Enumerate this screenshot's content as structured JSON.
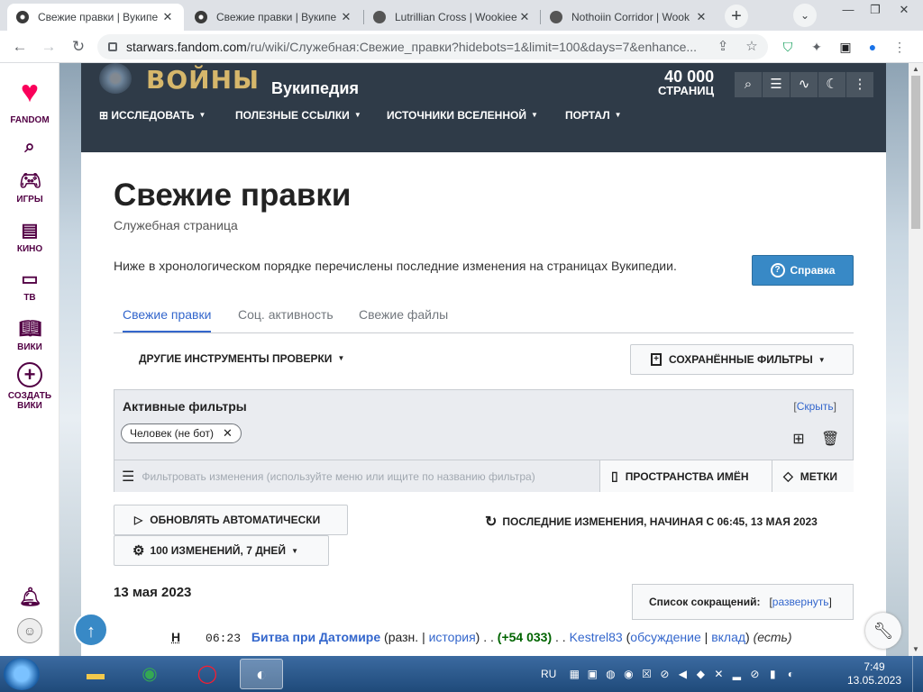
{
  "browser": {
    "tabs": [
      {
        "title": "Свежие правки | Вукипе",
        "active": true
      },
      {
        "title": "Свежие правки | Вукипе",
        "active": false
      },
      {
        "title": "Lutrillian Cross | Wookiee",
        "active": false
      },
      {
        "title": "Nothoiin Corridor | Wook",
        "active": false
      }
    ],
    "new_tab": "+",
    "url_host": "starwars.fandom.com",
    "url_rest": "/ru/wiki/Служебная:Свежие_правки?hidebots=1&limit=100&days=7&enhance..."
  },
  "rail": {
    "items": [
      {
        "label": "FANDOM",
        "icon": "fandom-logo-icon"
      },
      {
        "label": "",
        "icon": "search-icon"
      },
      {
        "label": "ИГРЫ",
        "icon": "gamepad-icon"
      },
      {
        "label": "КИНО",
        "icon": "clapperboard-icon"
      },
      {
        "label": "ТВ",
        "icon": "tv-icon"
      },
      {
        "label": "ВИКИ",
        "icon": "book-icon"
      },
      {
        "label": "СОЗДАТЬ ВИКИ",
        "icon": "plus-circle-icon"
      }
    ]
  },
  "wiki": {
    "logo_text": "ВОЙНЫ",
    "name": "Вукипедия",
    "page_count": "40 000",
    "page_count_label": "СТРАНИЦ",
    "nav": [
      {
        "label": "ИССЛЕДОВАТЬ",
        "icon": "explore-icon"
      },
      {
        "label": "ПОЛЕЗНЫЕ ССЫЛКИ"
      },
      {
        "label": "ИСТОЧНИКИ ВСЕЛЕННОЙ"
      },
      {
        "label": "ПОРТАЛ"
      }
    ]
  },
  "page": {
    "title": "Свежие правки",
    "subtitle": "Служебная страница",
    "intro": "Ниже в хронологическом порядке перечислены последние изменения на страницах Вукипедии.",
    "help_label": "Справка",
    "subtabs": [
      "Свежие правки",
      "Соц. активность",
      "Свежие файлы"
    ],
    "tools_label": "ДРУГИЕ ИНСТРУМЕНТЫ ПРОВЕРКИ",
    "saved_filters_label": "СОХРАНЁННЫЕ ФИЛЬТРЫ",
    "active_filters_title": "Активные фильтры",
    "hide_link": "Скрыть",
    "filter_chip": "Человек (не бот)",
    "filter_placeholder": "Фильтровать изменения (используйте меню или ищите по названию фильтра)",
    "namespaces_label": "ПРОСТРАНСТВА ИМЁН",
    "tags_label": "МЕТКИ",
    "auto_update_label": "ОБНОВЛЯТЬ АВТОМАТИЧЕСКИ",
    "since_label": "ПОСЛЕДНИЕ ИЗМЕНЕНИЯ, НАЧИНАЯ С 06:45, 13 МАЯ 2023",
    "count_label": "100 ИЗМЕНЕНИЙ, 7 ДНЕЙ",
    "day_heading": "13 мая 2023",
    "legend_label": "Список сокращений:",
    "legend_link": "развернуть"
  },
  "changes": [
    {
      "flag": "Н",
      "time": "06:23",
      "title": "Битва при Датомире",
      "diff": "разн.",
      "hist": "история",
      "size": "(+54 033)",
      "user": "Kestrel83",
      "talk": "обсуждение",
      "contribs": "вклад",
      "summary": "есть"
    }
  ],
  "taskbar": {
    "lang": "RU",
    "time": "7:49",
    "date": "13.05.2023"
  }
}
